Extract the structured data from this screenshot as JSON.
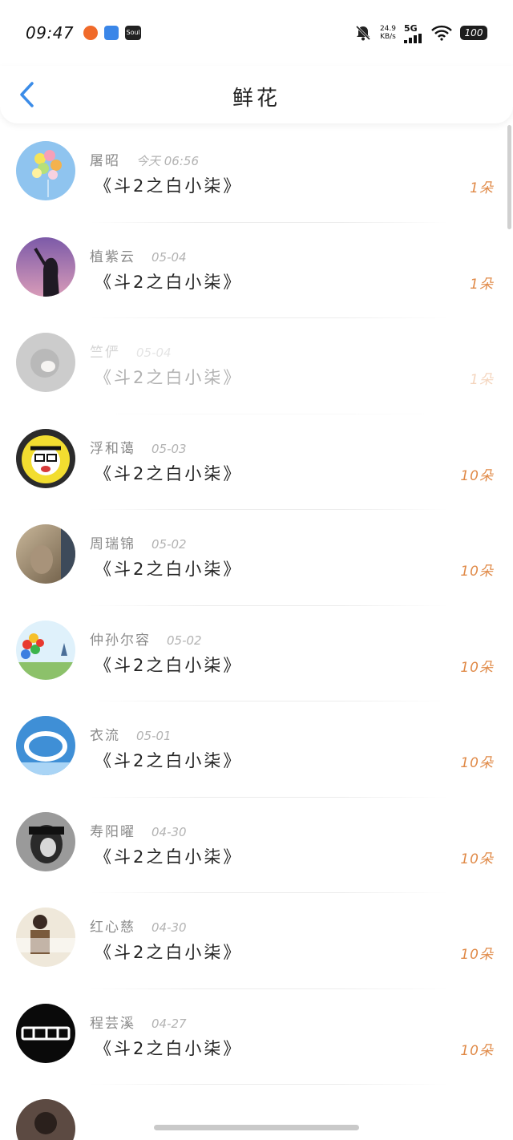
{
  "status_bar": {
    "time": "09:47",
    "net_speed_value": "24.9",
    "net_speed_unit": "KB/s",
    "network": "5G",
    "battery": "100"
  },
  "header": {
    "title": "鲜花"
  },
  "colors": {
    "accent_blue": "#3b8ce8",
    "count_orange": "#e08a48"
  },
  "items": [
    {
      "name": "屠昭",
      "date": "今天 06:56",
      "gift": "《斗2之白小柒》",
      "count": "1朵"
    },
    {
      "name": "植紫云",
      "date": "05-04",
      "gift": "《斗2之白小柒》",
      "count": "1朵"
    },
    {
      "name": "竺俨",
      "date": "05-04",
      "gift": "《斗2之白小柒》",
      "count": "1朵"
    },
    {
      "name": "浮和蔼",
      "date": "05-03",
      "gift": "《斗2之白小柒》",
      "count": "10朵"
    },
    {
      "name": "周瑞锦",
      "date": "05-02",
      "gift": "《斗2之白小柒》",
      "count": "10朵"
    },
    {
      "name": "仲孙尔容",
      "date": "05-02",
      "gift": "《斗2之白小柒》",
      "count": "10朵"
    },
    {
      "name": "衣流",
      "date": "05-01",
      "gift": "《斗2之白小柒》",
      "count": "10朵"
    },
    {
      "name": "寿阳曜",
      "date": "04-30",
      "gift": "《斗2之白小柒》",
      "count": "10朵"
    },
    {
      "name": "红心慈",
      "date": "04-30",
      "gift": "《斗2之白小柒》",
      "count": "10朵"
    },
    {
      "name": "程芸溪",
      "date": "04-27",
      "gift": "《斗2之白小柒》",
      "count": "10朵"
    }
  ]
}
